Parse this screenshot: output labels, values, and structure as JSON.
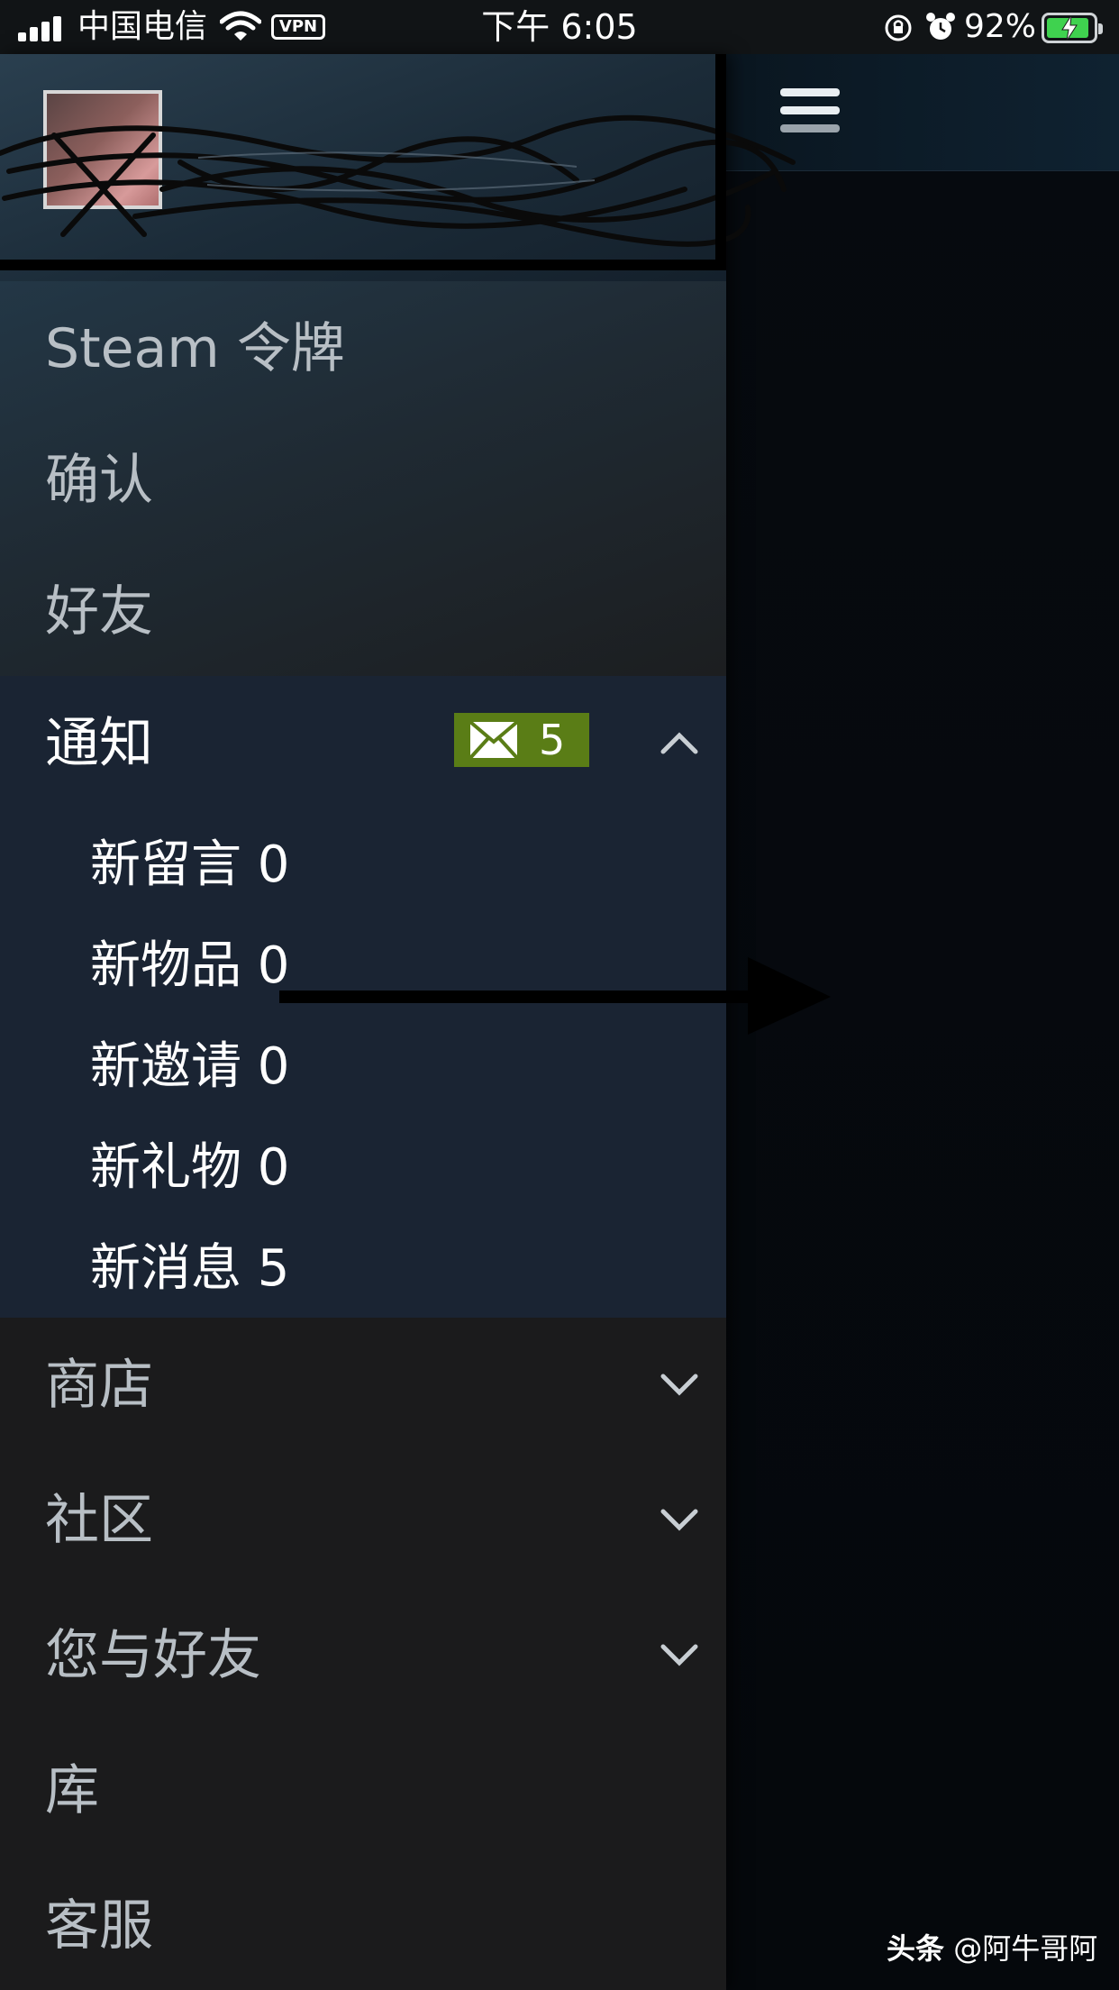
{
  "status_bar": {
    "carrier": "中国电信",
    "vpn": "VPN",
    "time": "下午 6:05",
    "battery_percent": "92%"
  },
  "drawer": {
    "top_items": [
      {
        "label": "Steam 令牌"
      },
      {
        "label": "确认"
      },
      {
        "label": "好友"
      }
    ],
    "notifications": {
      "label": "通知",
      "badge_count": "5",
      "sub_items": [
        {
          "label": "新留言 0"
        },
        {
          "label": "新物品 0"
        },
        {
          "label": "新邀请 0"
        },
        {
          "label": "新礼物 0"
        },
        {
          "label": "新消息 5"
        }
      ]
    },
    "lower_items": [
      {
        "label": "商店",
        "expandable": true
      },
      {
        "label": "社区",
        "expandable": true
      },
      {
        "label": "您与好友",
        "expandable": true
      },
      {
        "label": "库",
        "expandable": false
      },
      {
        "label": "客服",
        "expandable": false
      }
    ]
  },
  "watermark": {
    "brand": "头条",
    "handle": "@阿牛哥阿"
  },
  "colors": {
    "badge_green": "#5a7d16",
    "notif_bg": "#1a2433",
    "drawer_bg": "#1b1b1c"
  }
}
